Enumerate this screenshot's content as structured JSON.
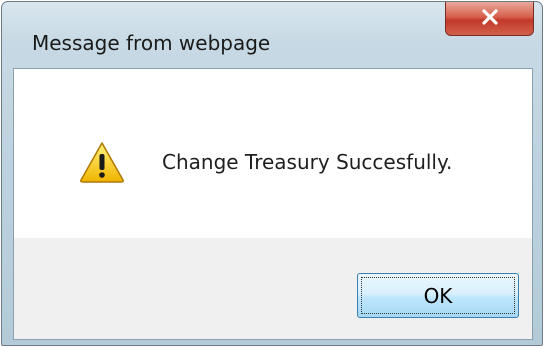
{
  "dialog": {
    "title": "Message from webpage",
    "message": "Change Treasury Succesfully.",
    "icon": "warning-icon",
    "ok_label": "OK",
    "close_icon": "close-icon"
  },
  "colors": {
    "close_button": "#c8432f",
    "frame": "#bcd2de",
    "ok_border": "#3c7fb1",
    "warning_fill": "#f5c31c"
  }
}
